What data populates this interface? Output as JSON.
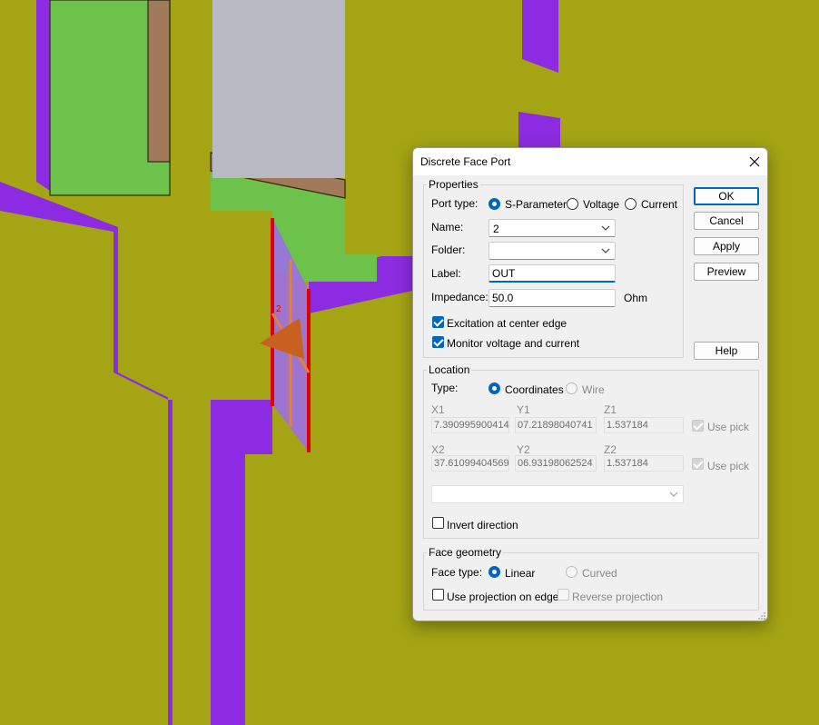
{
  "dialog": {
    "title": "Discrete Face Port",
    "buttons": {
      "ok": "OK",
      "cancel": "Cancel",
      "apply": "Apply",
      "preview": "Preview",
      "help": "Help"
    },
    "properties": {
      "group_title": "Properties",
      "port_type_label": "Port type:",
      "port_types": [
        "S-Parameter",
        "Voltage",
        "Current"
      ],
      "port_type_selected": "S-Parameter",
      "name_label": "Name:",
      "name_value": "2",
      "folder_label": "Folder:",
      "folder_value": "",
      "label_label": "Label:",
      "label_value": "OUT",
      "impedance_label": "Impedance:",
      "impedance_value": "50.0",
      "impedance_unit": "Ohm",
      "excitation_label": "Excitation at center edge",
      "excitation_checked": true,
      "monitor_label": "Monitor voltage and current",
      "monitor_checked": true
    },
    "location": {
      "group_title": "Location",
      "type_label": "Type:",
      "types": [
        "Coordinates",
        "Wire"
      ],
      "type_selected": "Coordinates",
      "x1_label": "X1",
      "y1_label": "Y1",
      "z1_label": "Z1",
      "x1": "7.390995900414",
      "y1": "07.21898040741",
      "z1": "1.537184",
      "x2_label": "X2",
      "y2_label": "Y2",
      "z2_label": "Z2",
      "x2": "37.61099404569",
      "y2": "06.93198062524",
      "z2": "1.537184",
      "use_pick_label": "Use pick",
      "use_pick1_checked": true,
      "use_pick2_checked": true,
      "wire_combo_value": "",
      "invert_label": "Invert direction",
      "invert_checked": false
    },
    "face_geometry": {
      "group_title": "Face geometry",
      "face_type_label": "Face type:",
      "face_types": [
        "Linear",
        "Curved"
      ],
      "face_type_selected": "Linear",
      "projection_label": "Use projection on edge",
      "projection_checked": false,
      "reverse_label": "Reverse projection",
      "reverse_checked": false
    }
  },
  "colors": {
    "background": "#a4a414",
    "purple": "#8d2be2",
    "green": "#6cc24a",
    "brown": "#a07a5a",
    "gray": "#b8b9c3",
    "port_red": "#e00000",
    "port_orange": "#e88030",
    "accent": "#0067c0"
  },
  "scene": {
    "port_label": "2"
  }
}
